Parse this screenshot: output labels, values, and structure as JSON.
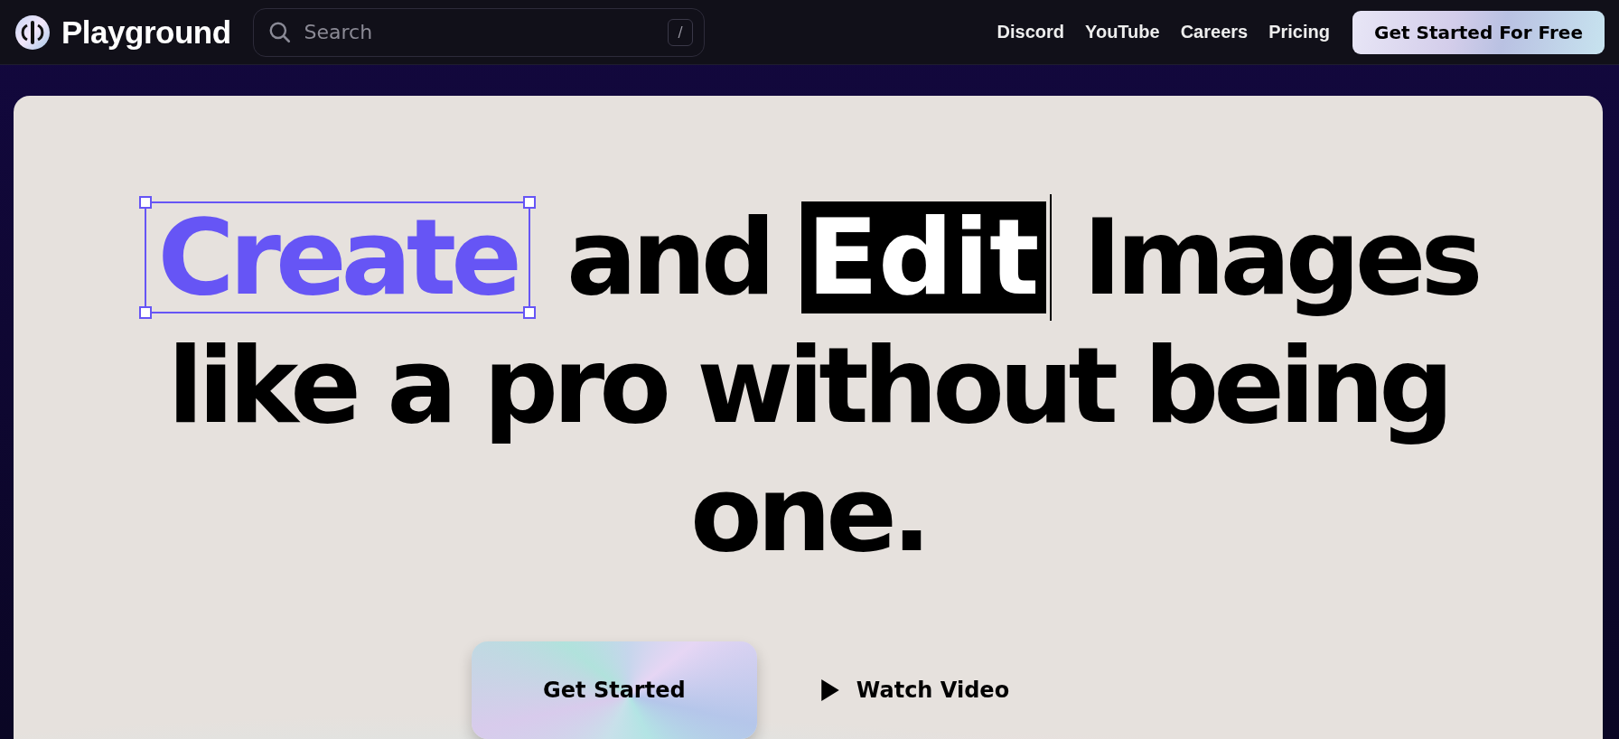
{
  "nav": {
    "brand": "Playground",
    "search": {
      "placeholder": "Search",
      "shortcut": "/"
    },
    "links": [
      "Discord",
      "YouTube",
      "Careers",
      "Pricing"
    ],
    "cta": "Get Started For Free"
  },
  "hero": {
    "words": [
      {
        "text": "Create",
        "kind": "selected"
      },
      {
        "text": "and",
        "kind": "plain"
      },
      {
        "text": "Edit",
        "kind": "highlighted"
      },
      {
        "text": "Images",
        "kind": "plain"
      }
    ],
    "rest": "like a pro without being one.",
    "buttons": [
      {
        "label": "Get Started",
        "kind": "primary"
      },
      {
        "label": "Watch Video",
        "kind": "video"
      }
    ]
  }
}
